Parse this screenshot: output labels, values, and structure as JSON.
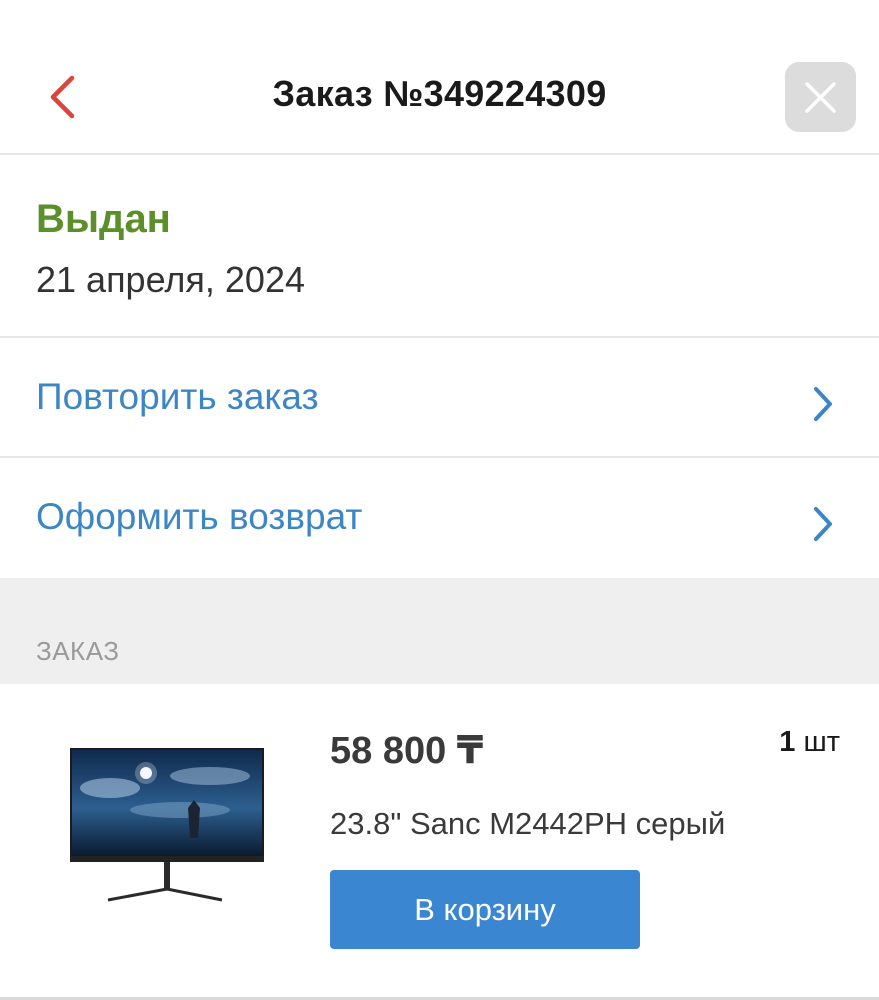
{
  "header": {
    "title": "Заказ №349224309",
    "back_icon": "chevron-left-icon",
    "close_icon": "close-icon",
    "accent_color": "#d9473c"
  },
  "status": {
    "label": "Выдан",
    "date": "21 апреля, 2024",
    "color": "#5a8f29"
  },
  "actions": [
    {
      "label": "Повторить заказ",
      "icon": "chevron-right-icon"
    },
    {
      "label": "Оформить возврат",
      "icon": "chevron-right-icon"
    }
  ],
  "order_section": {
    "title": "ЗАКАЗ",
    "items": [
      {
        "price": "58 800 ₸",
        "quantity_number": "1",
        "quantity_unit": "шт",
        "name": "23.8\" Sanc M2442PH серый",
        "cart_button_label": "В корзину",
        "image": "monitor-product-image"
      }
    ]
  },
  "colors": {
    "link": "#3d86c6",
    "button": "#3a86d1",
    "section_band": "#efefef"
  }
}
